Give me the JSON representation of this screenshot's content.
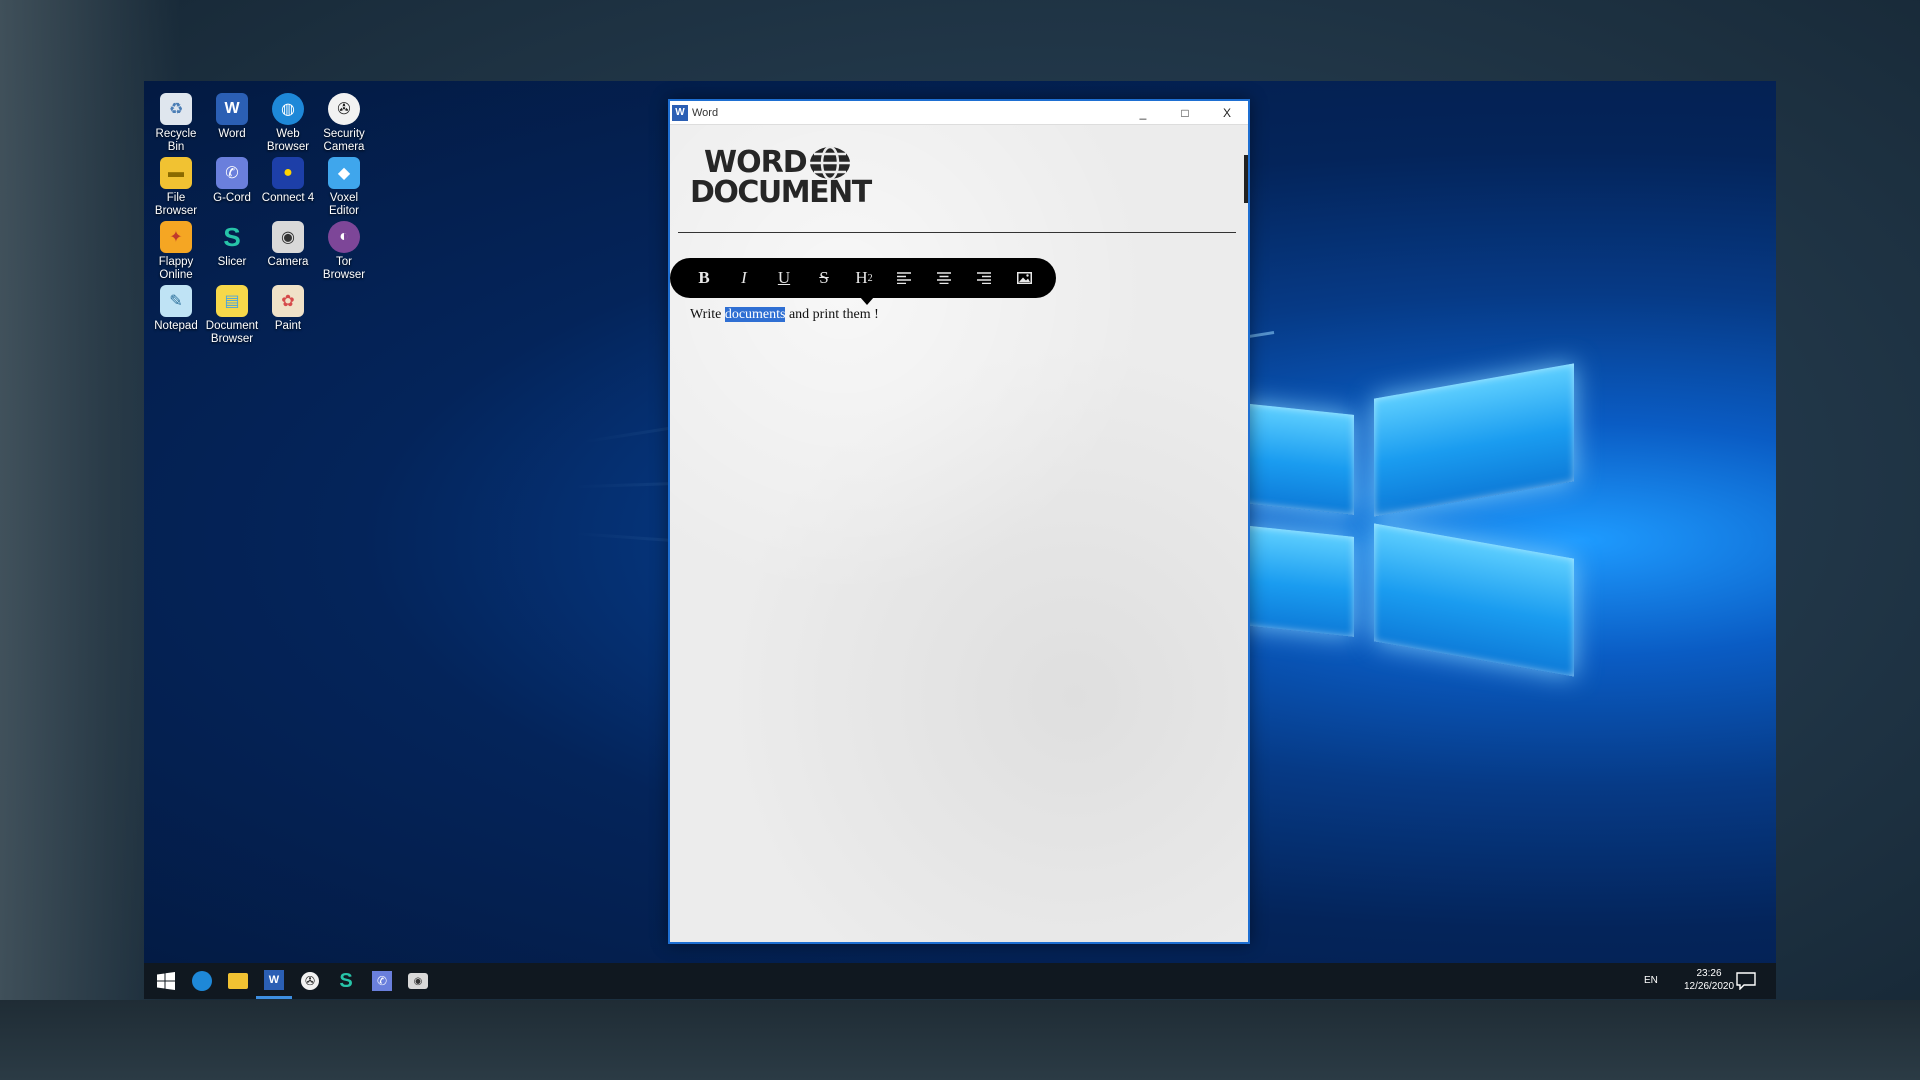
{
  "desktop": {
    "icons": [
      {
        "label": "Recycle Bin",
        "icon": "recycle-bin-icon"
      },
      {
        "label": "Word",
        "icon": "word-icon"
      },
      {
        "label": "Web Browser",
        "icon": "globe-icon"
      },
      {
        "label": "Security Camera",
        "icon": "film-reel-icon"
      },
      {
        "label": "File Browser",
        "icon": "folder-icon"
      },
      {
        "label": "G-Cord",
        "icon": "phone-icon"
      },
      {
        "label": "Connect 4",
        "icon": "connect4-icon"
      },
      {
        "label": "Voxel Editor",
        "icon": "cube-icon"
      },
      {
        "label": "Flappy Online",
        "icon": "bird-icon"
      },
      {
        "label": "Slicer",
        "icon": "slicer-icon"
      },
      {
        "label": "Camera",
        "icon": "camera-icon"
      },
      {
        "label": "Tor Browser",
        "icon": "onion-icon"
      },
      {
        "label": "Notepad",
        "icon": "notepad-icon"
      },
      {
        "label": "Document Browser",
        "icon": "folder-doc-icon"
      },
      {
        "label": "Paint",
        "icon": "paint-palette-icon"
      }
    ]
  },
  "window": {
    "title": "Word",
    "minimize": "_",
    "maximize": "□",
    "close": "X",
    "brand_line1": "WORD",
    "brand_line2": "DOCUMENT"
  },
  "toolbar": {
    "bold": "B",
    "italic": "I",
    "underline": "U",
    "strike": "S",
    "heading": "H",
    "heading_sup": "2"
  },
  "document": {
    "before": "Write ",
    "selected": "documents",
    "after": " and print them !"
  },
  "taskbar": {
    "lang": "EN",
    "time": "23:26",
    "date": "12/26/2020"
  },
  "colors": {
    "accent": "#1e6fd2",
    "selection": "#2f6fd3",
    "taskbar": "#101820"
  }
}
